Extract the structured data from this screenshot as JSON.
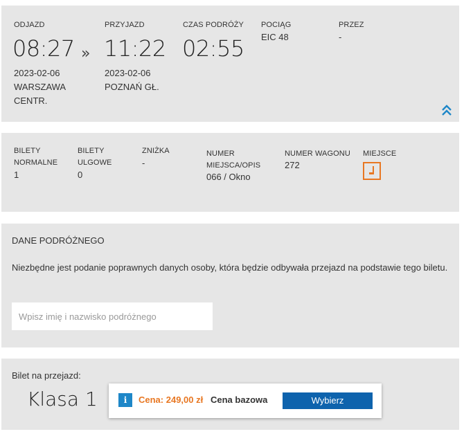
{
  "journey": {
    "departure": {
      "label": "ODJAZD",
      "time": "08:27",
      "date": "2023-02-06",
      "station_line1": "WARSZAWA",
      "station_line2": "CENTR."
    },
    "arrow": "»",
    "arrival": {
      "label": "PRZYJAZD",
      "time": "11:22",
      "date": "2023-02-06",
      "station": "POZNAŃ GŁ."
    },
    "duration": {
      "label": "CZAS PODRÓŻY",
      "value": "02:55"
    },
    "train": {
      "label": "POCIĄG",
      "value": "EIC 48"
    },
    "via": {
      "label": "PRZEZ",
      "value": "-"
    },
    "collapse_icon": "double-chevron-up-icon"
  },
  "tickets": {
    "normal": {
      "label_line1": "BILETY",
      "label_line2": "NORMALNE",
      "value": "1"
    },
    "reduced": {
      "label_line1": "BILETY",
      "label_line2": "ULGOWE",
      "value": "0"
    },
    "discount": {
      "label": "ZNIŻKA",
      "value": "-"
    },
    "seat_number": {
      "label_line1": "NUMER",
      "label_line2": "MIEJSCA/OPIS",
      "value": "066 / Okno"
    },
    "carriage": {
      "label": "NUMER WAGONU",
      "value": "272"
    },
    "seat": {
      "label": "MIEJSCE",
      "icon": "seat-icon"
    }
  },
  "passenger": {
    "title": "DANE PODRÓŻNEGO",
    "text": "Niezbędne jest podanie poprawnych danych osoby, która będzie odbywała przejazd na podstawie tego biletu.",
    "name_placeholder": "Wpisz imię i nazwisko podróżnego",
    "name_value": ""
  },
  "fare": {
    "title": "Bilet na przejazd:",
    "class_name": "Klasa 1",
    "info_icon": "info-icon",
    "info_glyph": "i",
    "price": "Cena: 249,00 zł",
    "basis": "Cena bazowa",
    "select_label": "Wybierz"
  },
  "colors": {
    "panel_bg": "#e6e6e6",
    "accent_orange": "#e87722",
    "button_blue": "#0e63ad",
    "info_blue": "#1e87c8"
  }
}
